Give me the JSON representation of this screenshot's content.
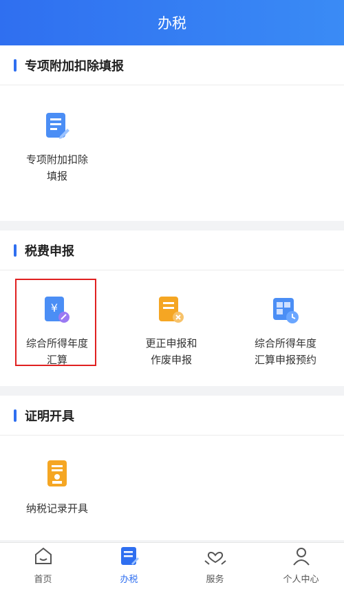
{
  "header": {
    "title": "办税"
  },
  "sections": [
    {
      "title": "专项附加扣除填报",
      "items": [
        {
          "label": "专项附加扣除\n填报",
          "icon": "form-edit-icon"
        }
      ]
    },
    {
      "title": "税费申报",
      "items": [
        {
          "label": "综合所得年度\n汇算",
          "icon": "yuan-doc-icon"
        },
        {
          "label": "更正申报和\n作废申报",
          "icon": "doc-cancel-icon"
        },
        {
          "label": "综合所得年度\n汇算申报预约",
          "icon": "calendar-clock-icon"
        }
      ]
    },
    {
      "title": "证明开具",
      "items": [
        {
          "label": "纳税记录开具",
          "icon": "certificate-icon"
        }
      ]
    }
  ],
  "tabbar": {
    "items": [
      {
        "label": "首页",
        "icon": "home-icon"
      },
      {
        "label": "办税",
        "icon": "tax-doc-icon",
        "active": true
      },
      {
        "label": "服务",
        "icon": "service-heart-icon"
      },
      {
        "label": "个人中心",
        "icon": "user-icon"
      }
    ]
  },
  "colors": {
    "accent": "#2f6ff0",
    "highlight": "#e02020",
    "orange": "#f5a623"
  }
}
